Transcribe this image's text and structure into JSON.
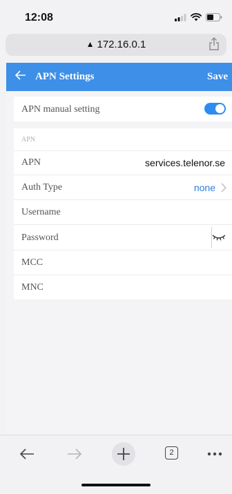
{
  "status_bar": {
    "time": "12:08"
  },
  "browser": {
    "url": "172.16.0.1",
    "tab_count": "2"
  },
  "app_bar": {
    "title": "APN Settings",
    "save_label": "Save"
  },
  "manual": {
    "label": "APN manual setting",
    "enabled": true
  },
  "section": {
    "header": "APN"
  },
  "fields": {
    "apn": {
      "label": "APN",
      "value": "services.telenor.se"
    },
    "auth_type": {
      "label": "Auth Type",
      "value": "none"
    },
    "username": {
      "label": "Username",
      "value": ""
    },
    "password": {
      "label": "Password",
      "value": ""
    },
    "mcc": {
      "label": "MCC",
      "value": ""
    },
    "mnc": {
      "label": "MNC",
      "value": ""
    }
  },
  "colors": {
    "accent": "#3d8fe7",
    "toggle_on": "#2d8cf0",
    "link": "#2d7fe0"
  }
}
